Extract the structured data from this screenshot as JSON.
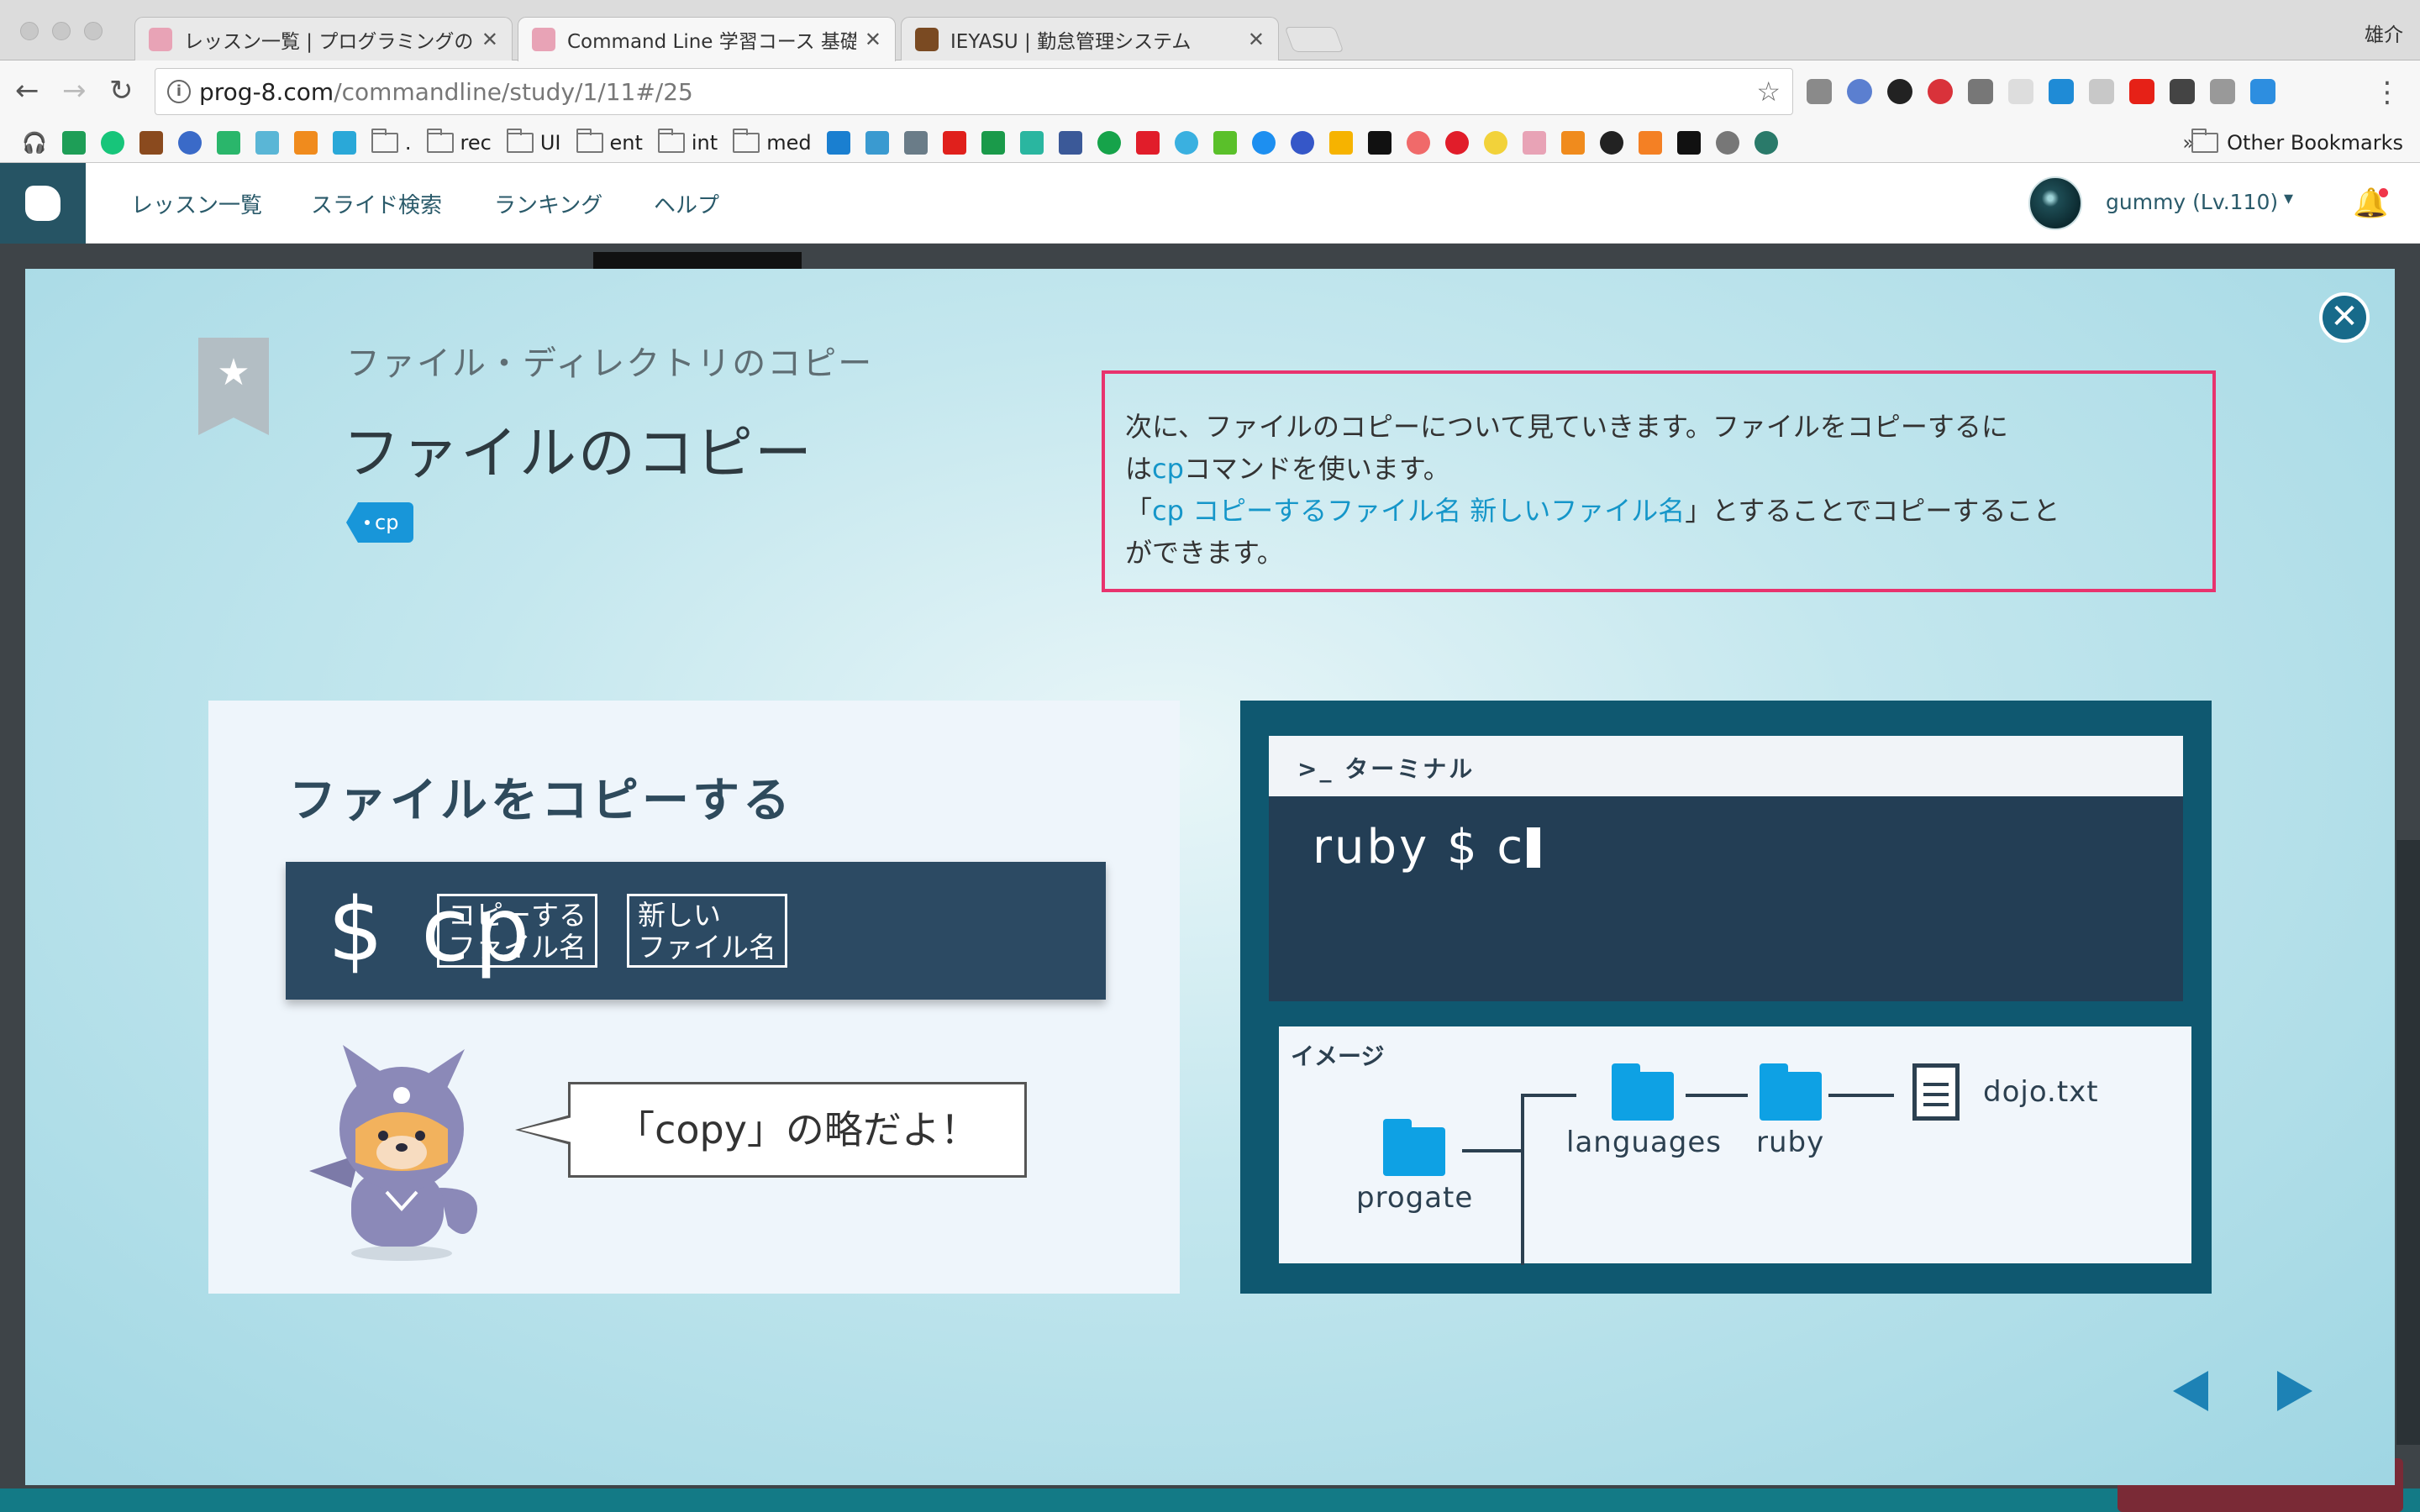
{
  "browser": {
    "tabs": [
      {
        "title": "レッスン一覧 | プログラミングの入",
        "color": "#e8a3b6"
      },
      {
        "title": "Command Line 学習コース 基礎編",
        "color": "#e8a3b6"
      },
      {
        "title": "IEYASU | 勤怠管理システム",
        "color": "#7a4a22"
      }
    ],
    "profile_name": "雄介",
    "url_host": "prog-8.com",
    "url_path": "/commandline/study/1/11#/25",
    "bookmarks": [
      "rec",
      "UI",
      "ent",
      "int",
      "med"
    ],
    "other_bookmarks": "Other Bookmarks",
    "dot_bookmark": "."
  },
  "site": {
    "nav": [
      "レッスン一覧",
      "スライド検索",
      "ランキング",
      "ヘルプ"
    ],
    "user_name": "gummy (Lv.110)",
    "caret": "▾",
    "bell": "🔔"
  },
  "modal": {
    "close": "✕",
    "subtitle": "ファイル・ディレクトリのコピー",
    "title": "ファイルのコピー",
    "tag": "cp",
    "explain": {
      "line1": "次に、ファイルのコピーについて見ていきます。ファイルをコピーするに",
      "line2_pre": "は",
      "line2_hl": "cp",
      "line2_post": "コマンドを使います。",
      "line3_open": "「",
      "line3_hl": "cp コピーするファイル名 新しいファイル名",
      "line3_post": "」とすることでコピーすること",
      "line4": "ができます。"
    },
    "left": {
      "heading": "ファイルをコピーする",
      "command": "$ cp",
      "arg1_l1": "コピーする",
      "arg1_l2": "ファイル名",
      "arg2_l1": "新しい",
      "arg2_l2": "ファイル名",
      "bubble": "「copy」の略だよ！"
    },
    "right": {
      "terminal_title": ">_ ターミナル",
      "prompt": "ruby $ c",
      "image_title": "イメージ",
      "folders": [
        "progate",
        "languages",
        "ruby"
      ],
      "file": "dojo.txt"
    }
  }
}
